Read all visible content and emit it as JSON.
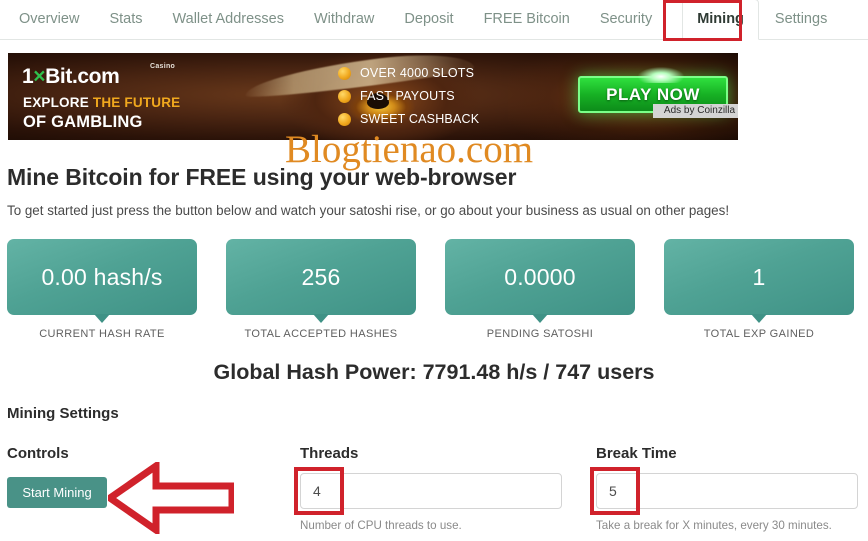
{
  "nav": {
    "items": [
      {
        "label": "Overview",
        "active": false
      },
      {
        "label": "Stats",
        "active": false
      },
      {
        "label": "Wallet Addresses",
        "active": false
      },
      {
        "label": "Withdraw",
        "active": false
      },
      {
        "label": "Deposit",
        "active": false
      },
      {
        "label": "FREE Bitcoin",
        "active": false
      },
      {
        "label": "Security",
        "active": false
      },
      {
        "label": "Mining",
        "active": true
      },
      {
        "label": "Settings",
        "active": false
      }
    ],
    "active_label": "Mining",
    "highlight_color": "#d0222b"
  },
  "banner": {
    "logo_prefix": "1",
    "logo_x": "×",
    "logo_suffix": "Bit.com",
    "casino_tag": "Casino",
    "line1_plain": "EXPLORE ",
    "line1_highlight": "THE FUTURE",
    "line2": "OF GAMBLING",
    "bullets": [
      "OVER 4000 SLOTS",
      "FAST PAYOUTS",
      "SWEET CASHBACK"
    ],
    "cta_label": "PLAY NOW",
    "ads_label": "Ads by Coinzilla",
    "cta_color": "#17b124",
    "highlight_color": "#f0a81e"
  },
  "watermark": {
    "text": "Blogtienao.com",
    "color": "#e08a22"
  },
  "page": {
    "title": "Mine Bitcoin for FREE using your web-browser",
    "subtitle": "To get started just press the button below and watch your satoshi rise, or go about your business as usual on other pages!",
    "global_hash_power": "Global Hash Power: 7791.48 h/s / 747 users"
  },
  "stats": [
    {
      "value": "0.00 hash/s",
      "label": "CURRENT HASH RATE"
    },
    {
      "value": "256",
      "label": "TOTAL ACCEPTED HASHES"
    },
    {
      "value": "0.0000",
      "label": "PENDING SATOSHI"
    },
    {
      "value": "1",
      "label": "TOTAL EXP GAINED"
    }
  ],
  "stat_card_color": "#4fa294",
  "settings": {
    "section_title": "Mining Settings",
    "controls_label": "Controls",
    "start_button_label": "Start Mining",
    "threads": {
      "label": "Threads",
      "value": "4",
      "placeholder": "4",
      "help": "Number of CPU threads to use."
    },
    "break_time": {
      "label": "Break Time",
      "value": "5",
      "placeholder": "5",
      "help": "Take a break for X minutes, every 30 minutes."
    }
  },
  "annotations": {
    "color": "#d0222b",
    "arrow_direction": "left",
    "arrow_target": "start-mining-button",
    "boxes": [
      "mining-tab",
      "threads-input",
      "break-time-input"
    ]
  }
}
